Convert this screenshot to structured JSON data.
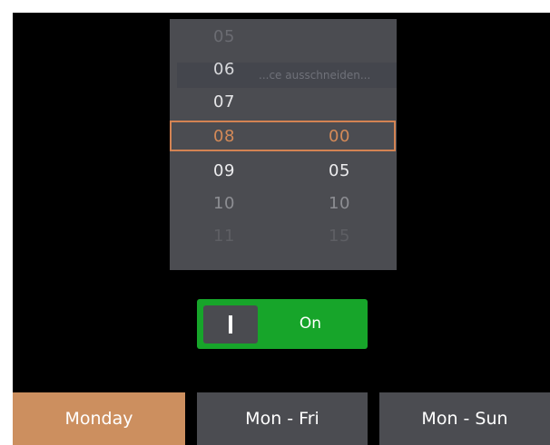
{
  "time_picker": {
    "ghost_text": "...ce ausschneiden...",
    "hours": [
      {
        "label": "05",
        "color": "#6b6c72"
      },
      {
        "label": "06",
        "color": "#d8d9dc"
      },
      {
        "label": "07",
        "color": "#e6e6e8"
      },
      {
        "label": "08",
        "color": "#d48a58"
      },
      {
        "label": "09",
        "color": "#ececee"
      },
      {
        "label": "10",
        "color": "#8d8e93"
      },
      {
        "label": "11",
        "color": "#5e5f64"
      }
    ],
    "minutes": [
      {
        "label": "00",
        "color": "#d48a58"
      },
      {
        "label": "05",
        "color": "#ececee"
      },
      {
        "label": "10",
        "color": "#8d8e93"
      },
      {
        "label": "15",
        "color": "#5e5f64"
      }
    ],
    "selected_hour": "08",
    "selected_minute": "00"
  },
  "toggle": {
    "state_label": "On",
    "on": true,
    "color": "#17a52a"
  },
  "day_buttons": [
    {
      "label": "Monday",
      "selected": true
    },
    {
      "label": "Mon - Fri",
      "selected": false
    },
    {
      "label": "Mon - Sun",
      "selected": false
    }
  ],
  "colors": {
    "accent": "#cc8f5f",
    "panel": "#4b4c51",
    "background": "#000000"
  }
}
